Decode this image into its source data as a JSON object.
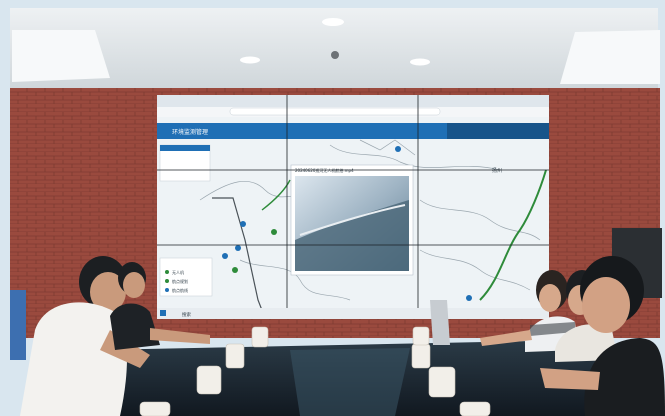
{
  "screen": {
    "app_title": "环境监测管理",
    "panel_items": [
      "无人机",
      "航点规划",
      "航点航线"
    ],
    "video_title": "20240620巡河无人机航拍.mp4",
    "map_label": "扬州",
    "taskbar_search": "搜索"
  },
  "colors": {
    "wall_brick": "#9a4a3e",
    "ceiling": "#e7ecef",
    "screen_bg": "#eef3f6",
    "app_header": "#1f6fb5",
    "river": "#2e8b3a",
    "table": "#1b2530"
  }
}
